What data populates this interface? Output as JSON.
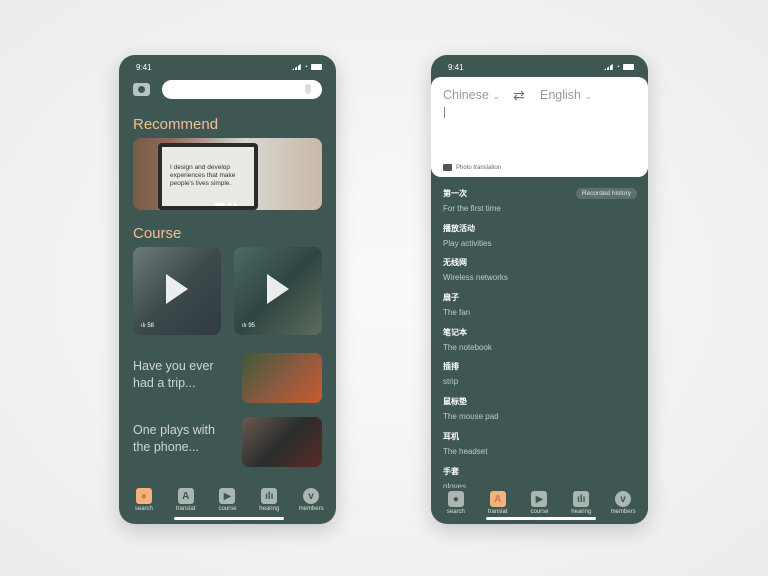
{
  "left": {
    "status_time": "9:41",
    "recommend_title": "Recommend",
    "banner_text": "I design and develop experiences that make people's lives simple.",
    "course_title": "Course",
    "videos": [
      {
        "count": "58"
      },
      {
        "count": "95"
      }
    ],
    "stories": [
      "Have you ever had a trip...",
      "One plays with the phone..."
    ]
  },
  "right": {
    "status_time": "9:41",
    "source_lang": "Chinese",
    "target_lang": "English",
    "photo_translation": "Photo translation",
    "history_badge": "Recorded history",
    "history": [
      {
        "zh": "第一次",
        "en": "For the first time"
      },
      {
        "zh": "播放活动",
        "en": "Play activities"
      },
      {
        "zh": "无线网",
        "en": "Wireless networks"
      },
      {
        "zh": "扇子",
        "en": "The fan"
      },
      {
        "zh": "笔记本",
        "en": "The notebook"
      },
      {
        "zh": "插排",
        "en": "strip"
      },
      {
        "zh": "鼠标垫",
        "en": "The mouse pad"
      },
      {
        "zh": "耳机",
        "en": "The headset"
      },
      {
        "zh": "手套",
        "en": "gloves"
      }
    ]
  },
  "nav": [
    {
      "label": "search",
      "icon": "search-icon"
    },
    {
      "label": "translat",
      "icon": "translate-icon",
      "glyph": "A"
    },
    {
      "label": "course",
      "icon": "play-icon",
      "glyph": "▶"
    },
    {
      "label": "hearing",
      "icon": "bars-icon",
      "glyph": "ılı"
    },
    {
      "label": "members",
      "icon": "members-icon",
      "glyph": "v"
    }
  ],
  "colors": {
    "phone_bg": "#3f5752",
    "accent": "#f3c08e",
    "active_tab": "#f2b27f"
  }
}
